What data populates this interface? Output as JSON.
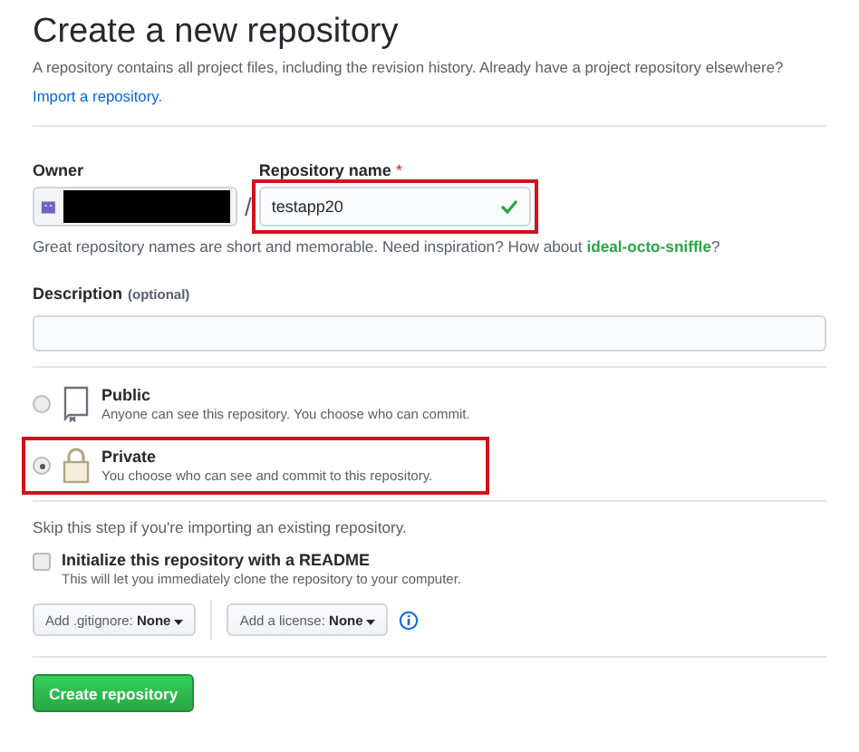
{
  "title": "Create a new repository",
  "intro": "A repository contains all project files, including the revision history. Already have a project repository elsewhere?",
  "import_link": "Import a repository.",
  "owner": {
    "label": "Owner",
    "redacted": true
  },
  "separator": "/",
  "repo_name": {
    "label": "Repository name",
    "required_mark": "*",
    "value": "testapp20",
    "valid": true,
    "highlighted": true
  },
  "name_hint": {
    "text": "Great repository names are short and memorable. Need inspiration? How about",
    "suggestion": "ideal-octo-sniffle",
    "end": "?"
  },
  "description": {
    "label": "Description",
    "optional": "(optional)"
  },
  "visibility": [
    {
      "kind": "book",
      "title": "Public",
      "text": "Anyone can see this repository. You choose who can commit.",
      "selected": false,
      "highlighted": false
    },
    {
      "kind": "lock",
      "title": "Private",
      "text": "You choose who can see and commit to this repository.",
      "selected": true,
      "highlighted": true
    }
  ],
  "skip_note": "Skip this step if you're importing an existing repository.",
  "readme": {
    "label": "Initialize this repository with a README",
    "text": "This will let you immediately clone the repository to your computer.",
    "checked": false
  },
  "dropdowns": [
    {
      "label": "Add .gitignore:",
      "value": "None"
    },
    {
      "label": "Add a license:",
      "value": "None"
    }
  ],
  "submit": "Create repository"
}
